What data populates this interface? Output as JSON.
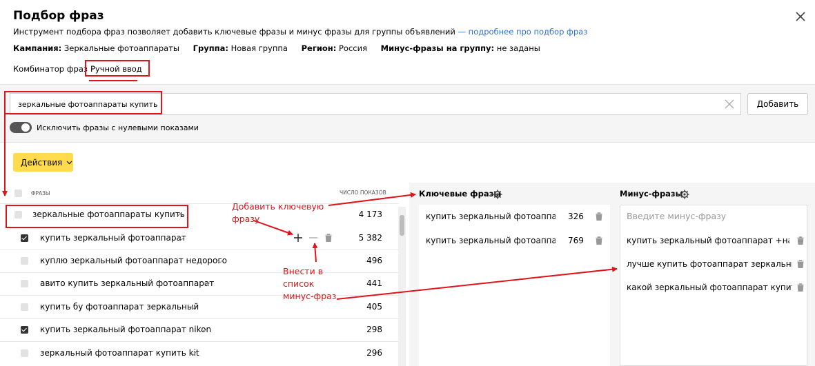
{
  "dialog": {
    "title": "Подбор фраз",
    "description": "Инструмент подбора фраз позволяет добавить ключевые фразы и минус фразы для группы объявлений",
    "link": "— подробнее про подбор фраз"
  },
  "meta": {
    "campaign_label": "Кампания:",
    "campaign_value": "Зеркальные фотоаппараты",
    "group_label": "Группа:",
    "group_value": "Новая группа",
    "region_label": "Регион:",
    "region_value": "Россия",
    "minus_label": "Минус-фразы на группу:",
    "minus_value": "не заданы"
  },
  "tabs": [
    {
      "label": "Комбинатор фраз",
      "active": false
    },
    {
      "label": "Ручной ввод",
      "active": true
    }
  ],
  "search": {
    "value": "зеркальные фотоаппараты купить",
    "add_label": "Добавить"
  },
  "toggle": {
    "label": "Исключить фразы с нулевыми показами",
    "on": true
  },
  "actions_label": "Действия",
  "phrases": {
    "header_phrases": "ФРАЗЫ",
    "header_count": "ЧИСЛО ПОКАЗОВ",
    "rows": [
      {
        "text": "зеркальные фотоаппараты купить",
        "count": "4 173",
        "checked": false,
        "expanded": true
      },
      {
        "text": "купить зеркальный фотоаппарат",
        "count": "5 382",
        "checked": true
      },
      {
        "text": "куплю зеркальный фотоаппарат недорого",
        "count": "496",
        "checked": false
      },
      {
        "text": "авито купить зеркальный фотоаппарат",
        "count": "441",
        "checked": false
      },
      {
        "text": "купить бу фотоаппарат зеркальный",
        "count": "405",
        "checked": false
      },
      {
        "text": "купить зеркальный фотоаппарат nikon",
        "count": "298",
        "checked": true
      },
      {
        "text": "зеркальный фотоаппарат купить kit",
        "count": "296",
        "checked": false
      }
    ]
  },
  "keywords": {
    "title": "Ключевые фразы",
    "items": [
      {
        "text": "купить зеркальный фотоаппарат...",
        "count": "326"
      },
      {
        "text": "купить зеркальный фотоаппа...",
        "count": "769"
      }
    ]
  },
  "minus": {
    "title": "Минус-фразы",
    "placeholder": "Введите минус-фразу",
    "items": [
      {
        "text": "купить зеркальный фотоаппарат +на а..."
      },
      {
        "text": "лучше купить фотоаппарат зеркальный"
      },
      {
        "text": "какой зеркальный фотоаппарат купить"
      }
    ]
  },
  "annotations": {
    "add_keyword_line1": "Добавить ключевую",
    "add_keyword_line2": "фразу",
    "to_minus_line1": "Внести в",
    "to_minus_line2": "список",
    "to_minus_line3": "минус-фраз"
  },
  "colors": {
    "accent_red": "#e0121a",
    "button_yellow": "#ffdb4d",
    "link_blue": "#2e6fd6"
  }
}
